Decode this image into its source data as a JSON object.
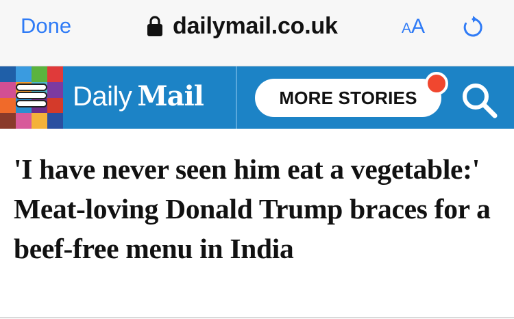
{
  "browser": {
    "done_label": "Done",
    "url": "dailymail.co.uk",
    "text_size_small": "A",
    "text_size_big": "A",
    "lock_icon": "lock-icon",
    "reload_icon": "reload-icon"
  },
  "site": {
    "logo_daily": "Daily",
    "logo_mail": "Mail",
    "more_stories_label": "MORE STORIES",
    "menu_icon": "menu-icon",
    "search_icon": "search-icon",
    "header_color": "#1c83c6",
    "notification_color": "#f0472f",
    "mosaic_colors": [
      "#1f5fa8",
      "#3a9be0",
      "#5bb33e",
      "#e03a3a",
      "#d24f93",
      "#f29a2e",
      "#4fb8c9",
      "#7c3aa0",
      "#f06a2a",
      "#2a8fd0",
      "#6d2d8a",
      "#d43a2a",
      "#8a3a2a",
      "#d85a9a",
      "#f4b23a",
      "#2a4fa0"
    ]
  },
  "article": {
    "headline": "'I have never seen him eat a vegetable:' Meat-loving Donald Trump braces for a beef-free menu in India"
  }
}
